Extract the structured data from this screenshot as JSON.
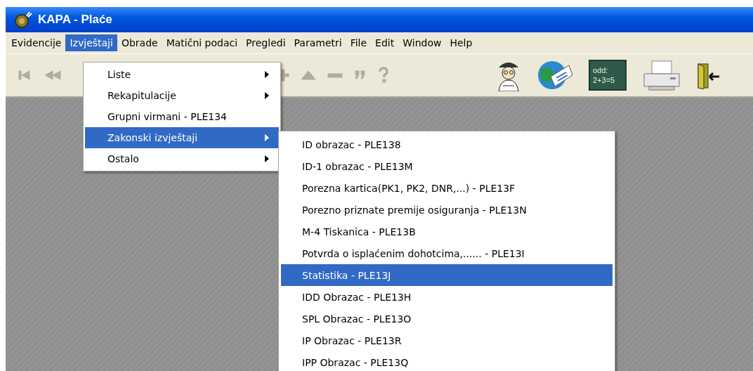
{
  "window": {
    "title": "KAPA - Plaće"
  },
  "menubar": [
    {
      "label": "Evidencije",
      "selected": false
    },
    {
      "label": "Izvještaji",
      "selected": true
    },
    {
      "label": "Obrade",
      "selected": false
    },
    {
      "label": "Matični podaci",
      "selected": false
    },
    {
      "label": "Pregledi",
      "selected": false
    },
    {
      "label": "Parametri",
      "selected": false
    },
    {
      "label": "File",
      "selected": false
    },
    {
      "label": "Edit",
      "selected": false
    },
    {
      "label": "Window",
      "selected": false
    },
    {
      "label": "Help",
      "selected": false
    }
  ],
  "toolbar": {
    "nav_buttons": [
      {
        "kind": "first",
        "disabled": true
      },
      {
        "kind": "prev",
        "disabled": true
      },
      {
        "kind": "plus",
        "disabled": true
      },
      {
        "kind": "up",
        "disabled": true
      },
      {
        "kind": "minus",
        "disabled": true
      },
      {
        "kind": "quote",
        "disabled": true
      },
      {
        "kind": "help",
        "disabled": true
      }
    ],
    "tools": [
      {
        "kind": "worker"
      },
      {
        "kind": "globe"
      },
      {
        "kind": "board",
        "lines": [
          "odd:",
          "2+3=5"
        ]
      },
      {
        "kind": "printer"
      },
      {
        "kind": "exit"
      }
    ]
  },
  "menu": [
    {
      "label": "Liste",
      "submenu": true,
      "selected": false
    },
    {
      "label": "Rekapitulacije",
      "submenu": true,
      "selected": false
    },
    {
      "label": "Grupni virmani - PLE134",
      "submenu": false,
      "selected": false
    },
    {
      "label": "Zakonski izvještaji",
      "submenu": true,
      "selected": true
    },
    {
      "label": "Ostalo",
      "submenu": true,
      "selected": false
    }
  ],
  "submenu": [
    {
      "label": "ID obrazac - PLE138",
      "selected": false
    },
    {
      "label": "ID-1 obrazac - PLE13M",
      "selected": false
    },
    {
      "label": "Porezna kartica(PK1, PK2, DNR,...) - PLE13F",
      "selected": false
    },
    {
      "label": "Porezno priznate premije osiguranja - PLE13N",
      "selected": false
    },
    {
      "label": "M-4 Tiskanica - PLE13B",
      "selected": false
    },
    {
      "label": "Potvrda o isplaćenim dohotcima,...... - PLE13I",
      "selected": false
    },
    {
      "label": "Statistika - PLE13J",
      "selected": true
    },
    {
      "label": "IDD Obrazac - PLE13H",
      "selected": false
    },
    {
      "label": "SPL Obrazac - PLE13O",
      "selected": false
    },
    {
      "label": "IP Obrazac - PLE13R",
      "selected": false
    },
    {
      "label": "IPP Obrazac - PLE13Q",
      "selected": false
    }
  ]
}
